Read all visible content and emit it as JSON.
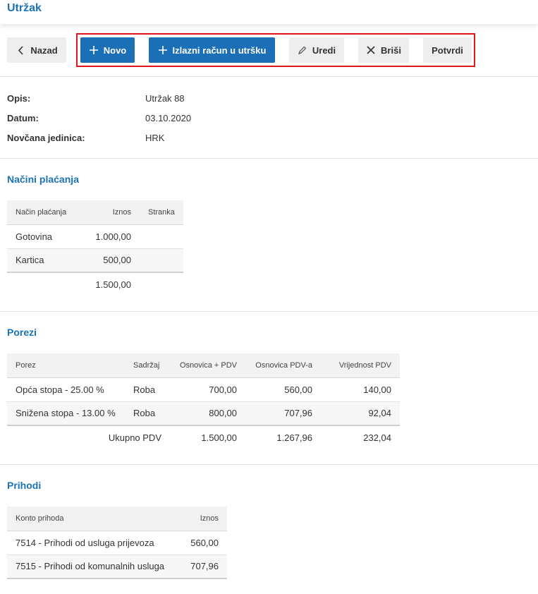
{
  "page": {
    "title": "Utržak"
  },
  "toolbar": {
    "back_label": "Nazad",
    "new_label": "Novo",
    "invoice_label": "Izlazni račun u utršku",
    "edit_label": "Uredi",
    "delete_label": "Briši",
    "confirm_label": "Potvrdi"
  },
  "info": {
    "opis_label": "Opis:",
    "opis_value": "Utržak 88",
    "datum_label": "Datum:",
    "datum_value": "03.10.2020",
    "valuta_label": "Novčana jedinica:",
    "valuta_value": "HRK"
  },
  "payments": {
    "title": "Načini plaćanja",
    "headers": [
      "Način plaćanja",
      "Iznos",
      "Stranka"
    ],
    "rows": [
      {
        "method": "Gotovina",
        "amount": "1.000,00",
        "party": ""
      },
      {
        "method": "Kartica",
        "amount": "500,00",
        "party": ""
      }
    ],
    "total": "1.500,00"
  },
  "taxes": {
    "title": "Porezi",
    "headers": [
      "Porez",
      "Sadržaj",
      "Osnovica + PDV",
      "Osnovica PDV-a",
      "Vrijednost PDV"
    ],
    "rows": [
      {
        "tax": "Opća stopa - 25.00 %",
        "content": "Roba",
        "gross": "700,00",
        "base": "560,00",
        "vat": "140,00"
      },
      {
        "tax": "Snižena stopa - 13.00 %",
        "content": "Roba",
        "gross": "800,00",
        "base": "707,96",
        "vat": "92,04"
      }
    ],
    "total_label": "Ukupno PDV",
    "total_gross": "1.500,00",
    "total_base": "1.267,96",
    "total_vat": "232,04"
  },
  "income": {
    "title": "Prihodi",
    "headers": [
      "Konto prihoda",
      "Iznos"
    ],
    "rows": [
      {
        "account": "7514 - Prihodi od usluga prijevoza",
        "amount": "560,00"
      },
      {
        "account": "7515 - Prihodi od komunalnih usluga",
        "amount": "707,96"
      }
    ]
  },
  "colors": {
    "brand_blue": "#1a73b8",
    "button_blue": "#1a6fb6",
    "highlight_red": "#e0161d"
  }
}
